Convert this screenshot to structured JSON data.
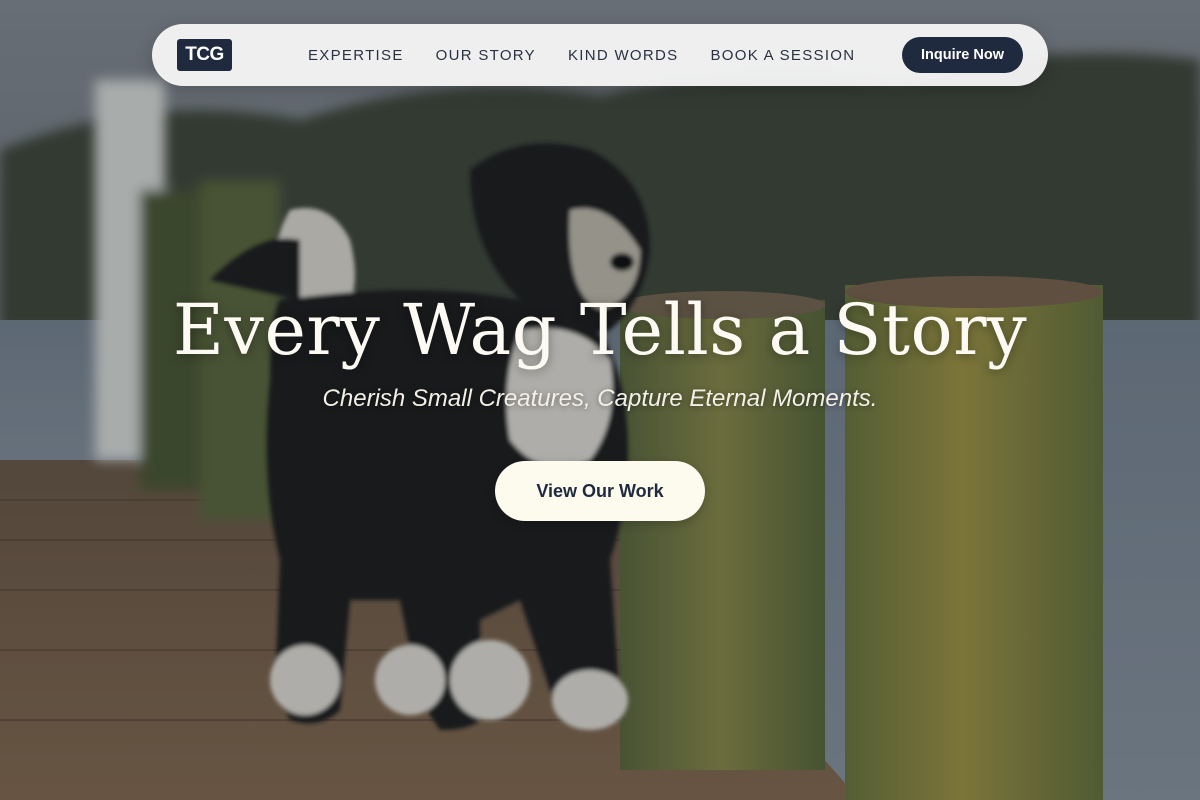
{
  "brand": {
    "logo_text": "TCG"
  },
  "nav": {
    "links": [
      {
        "label": "EXPERTISE"
      },
      {
        "label": "OUR STORY"
      },
      {
        "label": "KIND WORDS"
      },
      {
        "label": "BOOK A SESSION"
      }
    ],
    "cta_label": "Inquire Now"
  },
  "hero": {
    "title": "Every Wag Tells a Story",
    "subtitle": "Cherish Small Creatures, Capture Eternal Moments.",
    "button_label": "View Our Work",
    "background_image": "dog-on-pier-photo"
  },
  "colors": {
    "navy": "#1f2a3f",
    "cream": "#fdfaee",
    "nav_bg": "#f8f8f8"
  }
}
